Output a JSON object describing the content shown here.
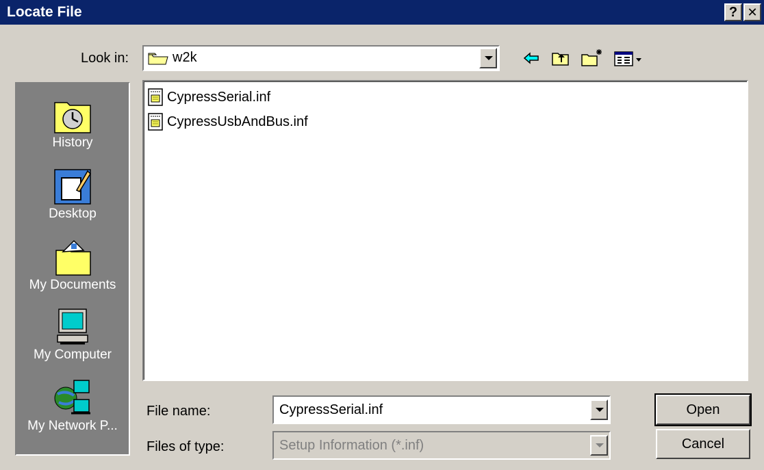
{
  "window": {
    "title": "Locate File",
    "help_label": "?",
    "close_label": "✕"
  },
  "lookin": {
    "label": "Look in:",
    "value": "w2k"
  },
  "toolbar": {
    "back": "back-arrow-icon",
    "up": "up-folder-icon",
    "newfolder": "new-folder-icon",
    "views": "view-menu-icon"
  },
  "places": [
    {
      "label": "History",
      "icon": "history-icon"
    },
    {
      "label": "Desktop",
      "icon": "desktop-icon"
    },
    {
      "label": "My Documents",
      "icon": "my-documents-icon"
    },
    {
      "label": "My Computer",
      "icon": "my-computer-icon"
    },
    {
      "label": "My Network P...",
      "icon": "network-icon"
    }
  ],
  "files": [
    {
      "name": "CypressSerial.inf"
    },
    {
      "name": "CypressUsbAndBus.inf"
    }
  ],
  "filename": {
    "label": "File name:",
    "value": "CypressSerial.inf"
  },
  "filetype": {
    "label": "Files of type:",
    "value": "Setup Information (*.inf)"
  },
  "buttons": {
    "open": "Open",
    "cancel": "Cancel"
  },
  "colors": {
    "titlebar": "#0a246a",
    "face": "#d4d0c8",
    "places_bg": "#808080"
  }
}
